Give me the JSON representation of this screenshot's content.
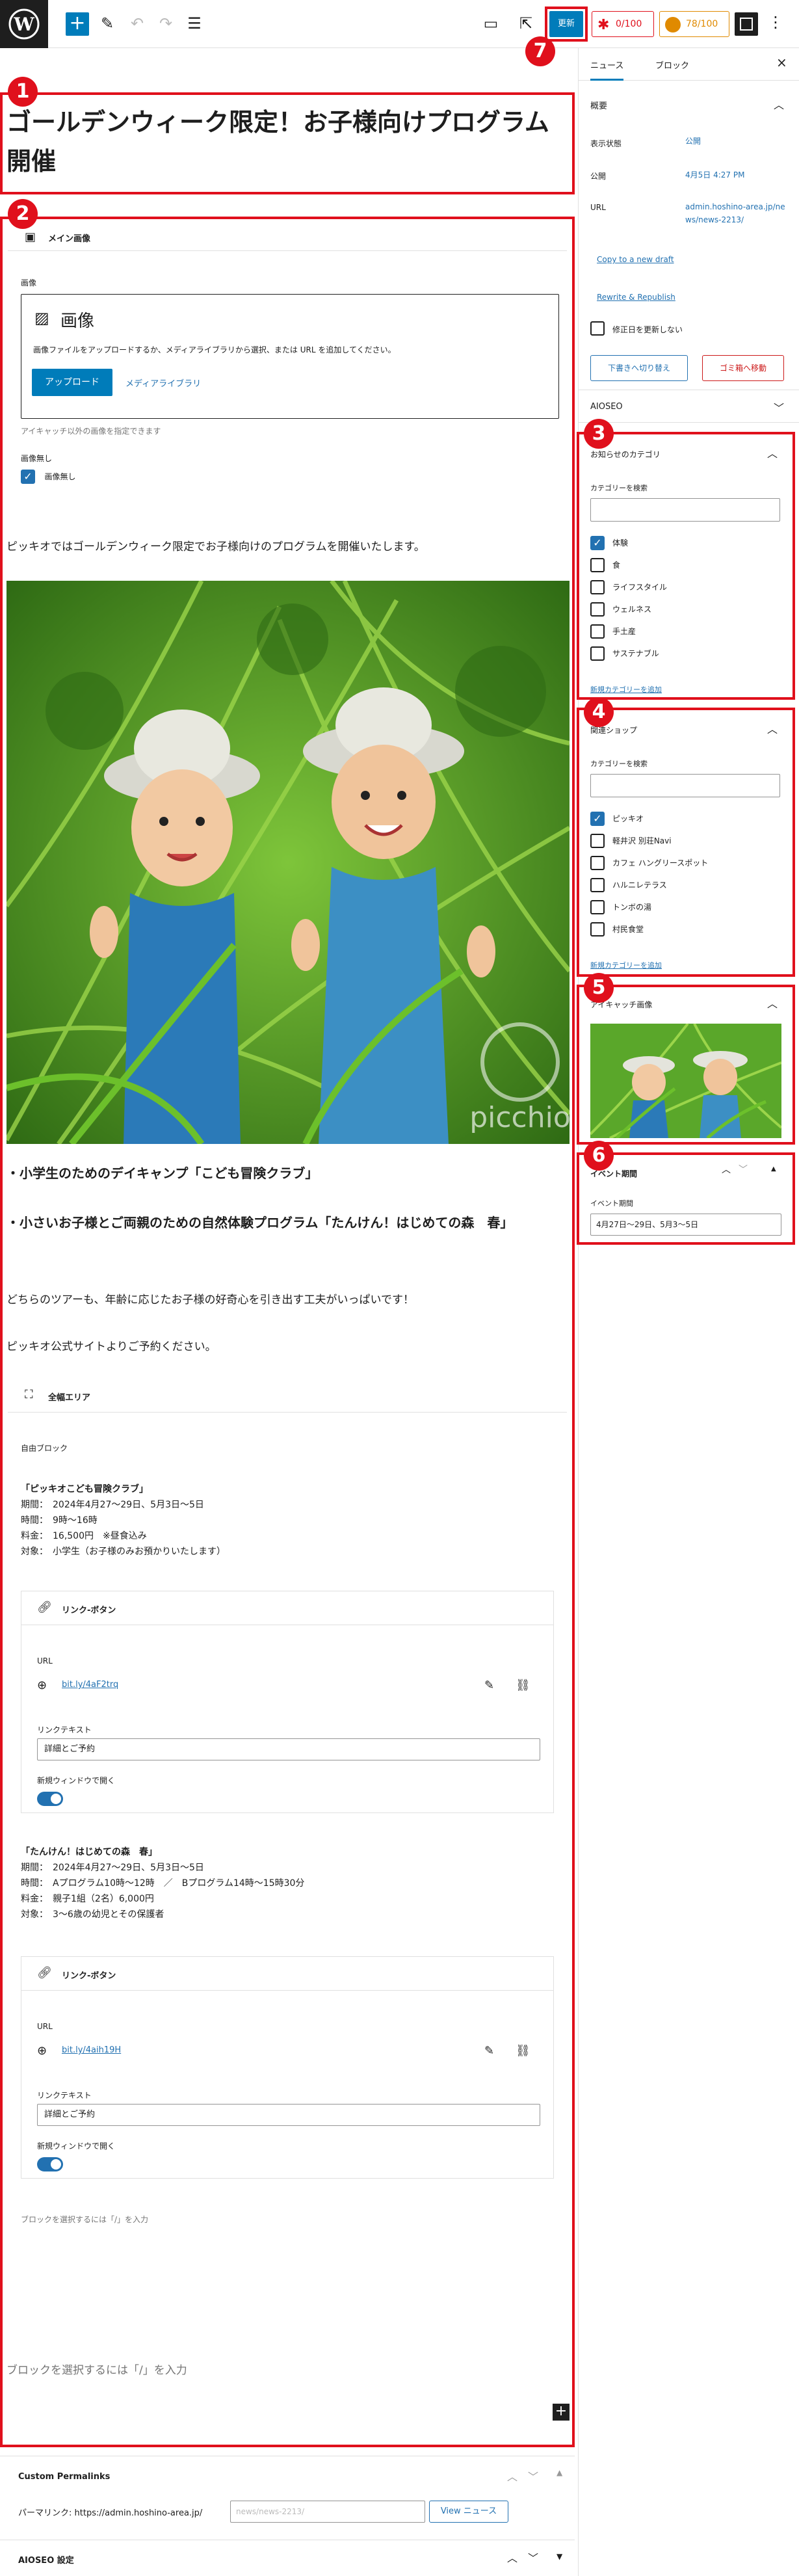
{
  "toolbar": {
    "update_label": "更新",
    "score_red": "0/100",
    "score_orange": "78/100"
  },
  "post": {
    "title": "ゴールデンウィーク限定！お子様向けプログラム開催"
  },
  "featured_block": {
    "heading": "メイン画像",
    "field_label": "画像",
    "placeholder_title": "画像",
    "placeholder_desc": "画像ファイルをアップロードするか、メディアライブラリから選択、または URL を追加してください。",
    "upload_label": "アップロード",
    "media_library_label": "メディアライブラリ",
    "help_text": "アイキャッチ以外の画像を指定できます",
    "no_image_label": "画像無し",
    "no_image_option": "画像無し"
  },
  "content": {
    "intro": "ピッキオではゴールデンウィーク限定でお子様向けのプログラムを開催いたします。",
    "photo_watermark": "picchio",
    "heading1": "・小学生のためのデイキャンプ「こども冒険クラブ」",
    "heading2": "・小さいお子様とご両親のための自然体験プログラム「たんけん！はじめての森　春」",
    "para1": "どちらのツアーも、年齢に応じたお子様の好奇心を引き出す工夫がいっぱいです！",
    "para2": "ピッキオ公式サイトよりご予約ください。",
    "fullwidth_label": "全幅エリア",
    "free_block_label": "自由ブロック",
    "prog1": {
      "title": "「ピッキオこども冒険クラブ」",
      "line1": "期間：　2024年4月27〜29日、5月3日〜5日",
      "line2": "時間：　9時〜16時",
      "line3": "料金：　16,500円　※昼食込み",
      "line4": "対象：　小学生（お子様のみお預かりいたします）"
    },
    "link1": {
      "title": "リンク-ボタン",
      "url_label": "URL",
      "url": "bit.ly/4aF2trq",
      "text_label": "リンクテキスト",
      "text_value": "詳細とご予約",
      "newwin_label": "新規ウィンドウで開く"
    },
    "prog2": {
      "title": "「たんけん！はじめての森　春」",
      "line1": "期間：　2024年4月27〜29日、5月3日〜5日",
      "line2": "時間：　Aプログラム10時〜12時　／　Bプログラム14時〜15時30分",
      "line3": "料金：　親子1組（2名）6,000円",
      "line4": "対象：　3〜6歳の幼児とその保護者"
    },
    "link2": {
      "title": "リンク-ボタン",
      "url_label": "URL",
      "url": "bit.ly/4aih19H",
      "text_label": "リンクテキスト",
      "text_value": "詳細とご予約",
      "newwin_label": "新規ウィンドウで開く"
    },
    "inner_placeholder": "ブロックを選択するには「/」を入力",
    "outer_placeholder": "ブロックを選択するには「/」を入力"
  },
  "meta": {
    "permalinks_title": "Custom Permalinks",
    "permalink_label": "パーマリンク: https://admin.hoshino-area.jp/",
    "permalink_placeholder": "news/news-2213/",
    "view_button": "View ニュース",
    "aioseo_title": "AIOSEO 設定"
  },
  "sidebar": {
    "tabs": [
      "ニュース",
      "ブロック"
    ],
    "summary": {
      "title": "概要",
      "visibility_label": "表示状態",
      "visibility_value": "公開",
      "publish_label": "公開",
      "publish_value": "4月5日 4:27 PM",
      "url_label": "URL",
      "url_value": "admin.hoshino-area.jp/news/news-2213/",
      "copy_label": "Copy to a new draft",
      "rewrite_label": "Rewrite & Republish",
      "no_update_label": "修正日を更新しない",
      "draft_button": "下書きへ切り替え",
      "trash_button": "ゴミ箱へ移動"
    },
    "aioseo": "AIOSEO",
    "news_cat": {
      "title": "お知らせのカテゴリ",
      "search_label": "カテゴリーを検索",
      "items": [
        {
          "label": "体験",
          "checked": true
        },
        {
          "label": "食",
          "checked": false
        },
        {
          "label": "ライフスタイル",
          "checked": false
        },
        {
          "label": "ウェルネス",
          "checked": false
        },
        {
          "label": "手土産",
          "checked": false
        },
        {
          "label": "サステナブル",
          "checked": false
        }
      ],
      "add_label": "新規カテゴリーを追加"
    },
    "shop": {
      "title": "関連ショップ",
      "search_label": "カテゴリーを検索",
      "items": [
        {
          "label": "ピッキオ",
          "checked": true
        },
        {
          "label": "軽井沢 別荘Navi",
          "checked": false
        },
        {
          "label": "カフェ ハングリースポット",
          "checked": false
        },
        {
          "label": "ハルニレテラス",
          "checked": false
        },
        {
          "label": "トンボの湯",
          "checked": false
        },
        {
          "label": "村民食堂",
          "checked": false
        }
      ],
      "add_label": "新規カテゴリーを追加"
    },
    "eyecatch": {
      "title": "アイキャッチ画像"
    },
    "event": {
      "title": "イベント期間",
      "label": "イベント期間",
      "value": "4月27日〜29日、5月3〜5日"
    }
  },
  "badges": [
    "1",
    "2",
    "3",
    "4",
    "5",
    "6",
    "7"
  ],
  "colors": {
    "annotation_red": "#e0101c",
    "wp_blue": "#007cba",
    "link_blue": "#2271b1",
    "trash_red": "#cc1818",
    "score_orange": "#e08a00"
  }
}
